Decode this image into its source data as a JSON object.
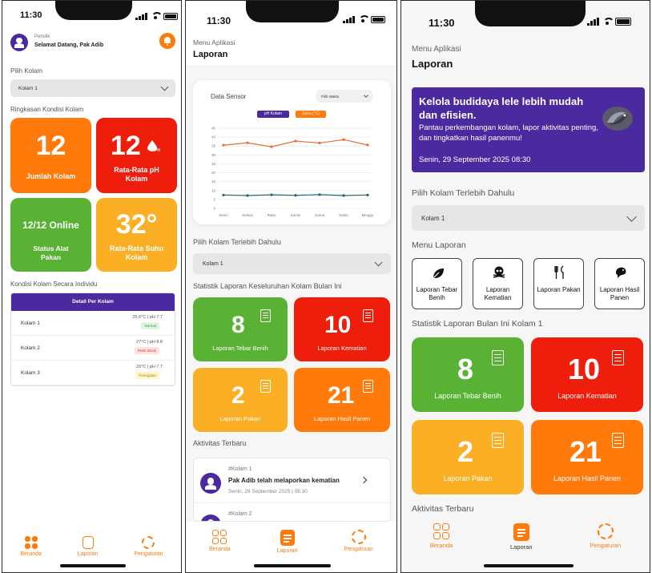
{
  "phone1": {
    "time": "11:30",
    "user_role": "Pemilik",
    "greeting": "Selamat Datang, Pak Adib",
    "pilih_kolam_label": "Pilih Kolam",
    "kolam_select": "Kolam 1",
    "ringkasan_label": "Ringkasan Kondisi Kolam",
    "cards": {
      "jumlah_value": "12",
      "jumlah_label": "Jumlah Kolam",
      "ph_value": "12",
      "ph_unit": "PH",
      "ph_label": "Rata-Rata pH Kolam",
      "status_value": "12/12 Online",
      "status_label": "Status Alat Pakan",
      "suhu_value": "32°",
      "suhu_label": "Rata-Rata Suhu Kolam"
    },
    "individu_label": "Kondisi Kolam Secara Individu",
    "table_header": "Detail Per Kolam",
    "rows": [
      {
        "name": "Kolam 1",
        "value": "25.6°C | pH 7.7",
        "badge": "Normal",
        "badge_color": "#2e9e44",
        "badge_bg": "#dff5e3"
      },
      {
        "name": "Kolam 2",
        "value": "27°C | pH 8.8",
        "badge": "Perlu Dicek",
        "badge_color": "#d93025",
        "badge_bg": "#fde2df"
      },
      {
        "name": "Kolam 3",
        "value": "26°C | pH 7.7",
        "badge": "Peringatan",
        "badge_color": "#b8860b",
        "badge_bg": "#fff4cc"
      }
    ],
    "nav": [
      "Beranda",
      "Laporan",
      "Pengaturan"
    ]
  },
  "phone2": {
    "time": "11:30",
    "menu_label": "Menu Aplikasi",
    "page_title": "Laporan",
    "chart_title": "Data Sensor",
    "chart_select": "Pilih Waktu",
    "pilih_label": "Pilih Kolam Terlebih Dahulu",
    "kolam_select": "Kolam 1",
    "statistik_label": "Statistik Laporan Keseluruhan Kolam Bulan Ini",
    "cards": [
      {
        "value": "8",
        "label": "Laporan Tebar Benih"
      },
      {
        "value": "10",
        "label": "Laporan Kematian"
      },
      {
        "value": "2",
        "label": "Laporan Pakan"
      },
      {
        "value": "21",
        "label": "Laporan Hasil Panen"
      }
    ],
    "aktivitas_label": "Aktivitas Terbaru",
    "activity": [
      {
        "kolam": "#Kolam 1",
        "title": "Pak Adib telah melaporkan kematian",
        "time": "Senin, 29 September 2025 | 08.30"
      },
      {
        "kolam": "#Kolam 2"
      }
    ],
    "nav": [
      "Beranda",
      "Laporan",
      "Pengaturan"
    ]
  },
  "chart_data": {
    "type": "line",
    "title": "Data Sensor",
    "categories": [
      "Senin",
      "Selasa",
      "Rabu",
      "Kamis",
      "Jumat",
      "Sabtu",
      "Minggu"
    ],
    "y_ticks": [
      0,
      5,
      10,
      15,
      20,
      25,
      30,
      35,
      40,
      45
    ],
    "ylim": [
      0,
      45
    ],
    "grid": true,
    "legend": "top",
    "series": [
      {
        "name": "pH Kolam",
        "color": "#4b2aa0",
        "line_color": "#1f6b6b",
        "values": [
          7.5,
          7.2,
          7.6,
          7.3,
          7.7,
          7.2,
          7.5
        ]
      },
      {
        "name": "Suhu (°C)",
        "color": "#ff7a0a",
        "line_color": "#e2703a",
        "values": [
          35.5,
          36.8,
          34.6,
          37.8,
          36.7,
          38.6,
          35.6
        ]
      }
    ]
  },
  "phone3": {
    "time": "11:30",
    "menu_label": "Menu Aplikasi",
    "page_title": "Laporan",
    "banner_title": "Kelola budidaya lele lebih mudah dan efisien.",
    "banner_text": "Pantau perkembangan kolam, lapor aktivitas penting, dan tingkatkan hasil panenmu!",
    "banner_date": "Senin, 29 September 2025 08:30",
    "pilih_label": "Pilih Kolam Terlebih Dahulu",
    "kolam_select": "Kolam 1",
    "menu_laporan_label": "Menu Laporan",
    "menu_items": [
      {
        "label": "Laporan Tebar Benih",
        "icon": "leaf-icon"
      },
      {
        "label": "Laporan Kematian",
        "icon": "skull-icon"
      },
      {
        "label": "Laporan Pakan",
        "icon": "cutlery-icon"
      },
      {
        "label": "Laporan Hasil Panen",
        "icon": "fish-icon"
      }
    ],
    "statistik_label": "Statistik Laporan Bulan Ini Kolam 1",
    "cards": [
      {
        "value": "8",
        "label": "Laporan Tebar Benih"
      },
      {
        "value": "10",
        "label": "Laporan Kematian"
      },
      {
        "value": "2",
        "label": "Laporan Pakan"
      },
      {
        "value": "21",
        "label": "Laporan Hasil Panen"
      }
    ],
    "aktivitas_label": "Aktivitas Terbaru",
    "nav": [
      "Beranda",
      "Laporan",
      "Pengaturan"
    ]
  }
}
